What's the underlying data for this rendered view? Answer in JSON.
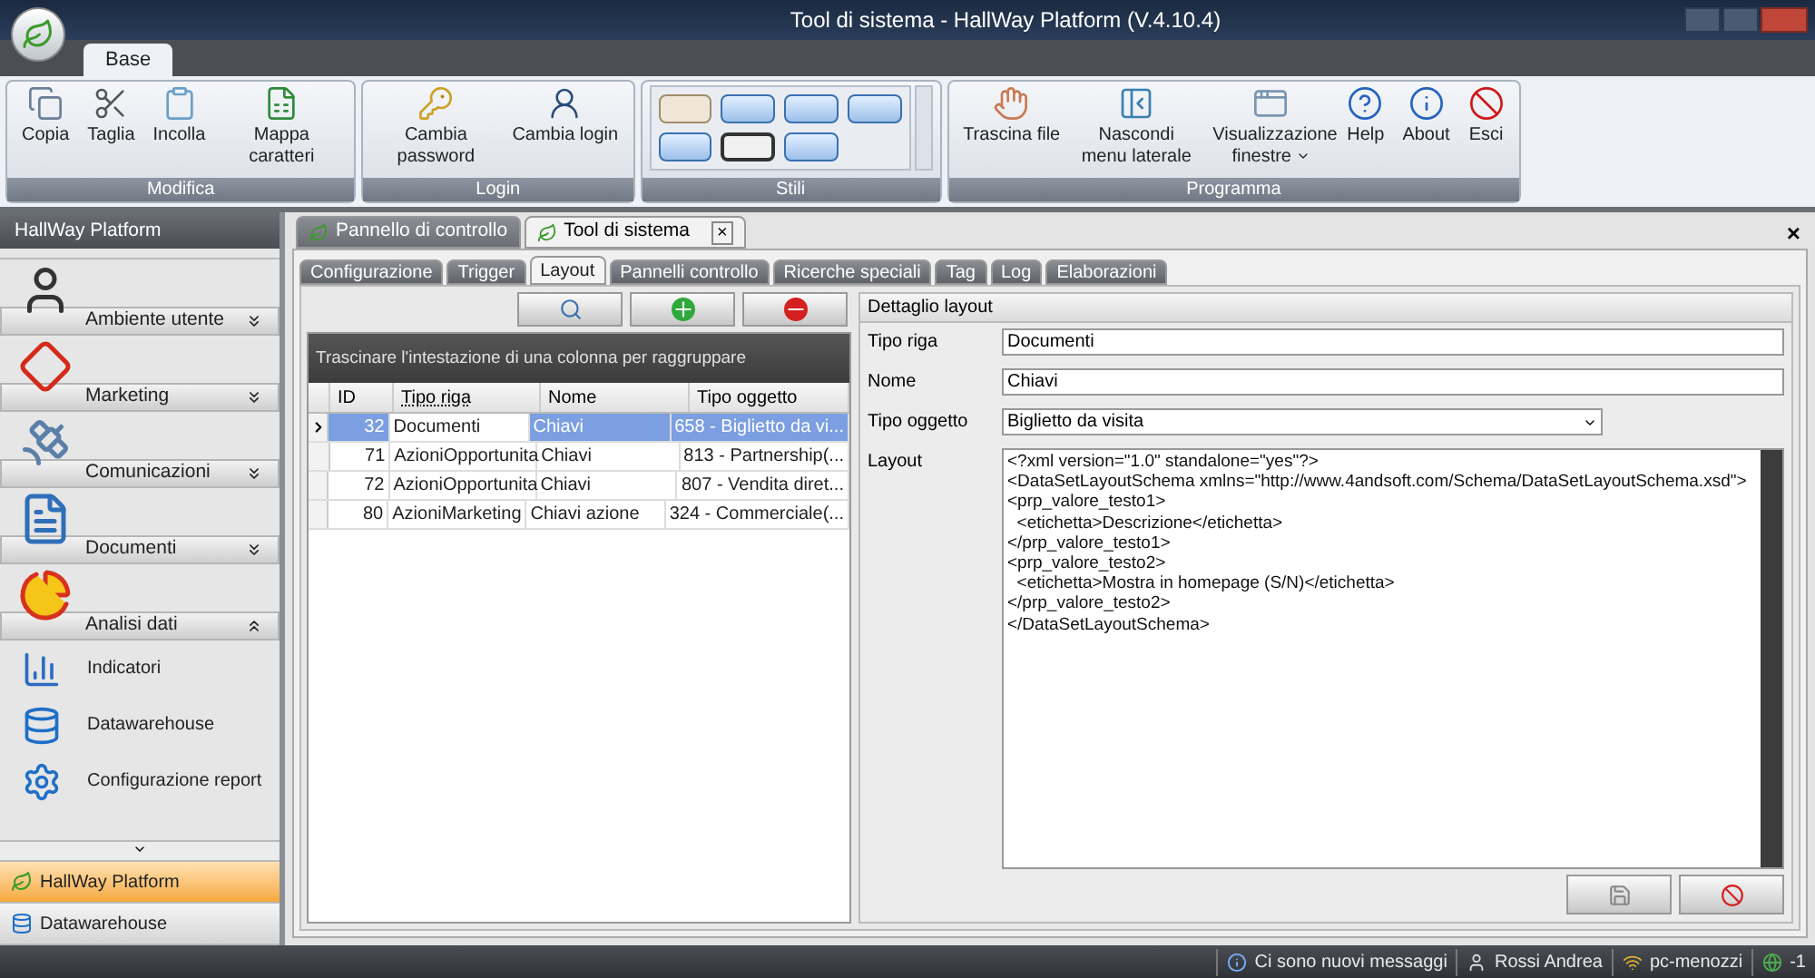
{
  "window": {
    "title": "Tool di sistema - HallWay Platform (V.4.10.4)"
  },
  "ribbon": {
    "tabs": [
      {
        "label": "Base",
        "selected": true
      }
    ],
    "groups": [
      {
        "title": "Modifica",
        "kind": "buttons",
        "items": [
          {
            "label": "Copia"
          },
          {
            "label": "Taglia"
          },
          {
            "label": "Incolla"
          },
          {
            "label": "Mappa caratteri"
          }
        ]
      },
      {
        "title": "Login",
        "kind": "buttons",
        "items": [
          {
            "label": "Cambia password"
          },
          {
            "label": "Cambia login"
          }
        ]
      },
      {
        "title": "Stili",
        "kind": "gallery"
      },
      {
        "title": "Programma",
        "kind": "buttons",
        "items": [
          {
            "label": "Trascina file"
          },
          {
            "label": "Nascondi menu laterale"
          },
          {
            "label": "Visualizzazione finestre",
            "dropdown": true
          },
          {
            "label": "Help"
          },
          {
            "label": "About"
          },
          {
            "label": "Esci"
          }
        ]
      }
    ]
  },
  "sidebar": {
    "title": "HallWay Platform",
    "groups": [
      {
        "label": "Ambiente utente",
        "expanded": false
      },
      {
        "label": "Marketing",
        "expanded": false
      },
      {
        "label": "Comunicazioni",
        "expanded": false
      },
      {
        "label": "Documenti",
        "expanded": false
      },
      {
        "label": "Analisi dati",
        "expanded": true,
        "items": [
          "Indicatori",
          "Datawarehouse",
          "Configurazione report"
        ]
      }
    ],
    "nav": [
      {
        "label": "HallWay Platform",
        "selected": true
      },
      {
        "label": "Datawarehouse",
        "selected": false
      }
    ]
  },
  "doc_tabs": [
    {
      "label": "Pannello di controllo",
      "selected": false,
      "closable": false
    },
    {
      "label": "Tool di sistema",
      "selected": true,
      "closable": true,
      "close_label": "×"
    }
  ],
  "close_all": "×",
  "tabs": [
    {
      "label": "Configurazione",
      "selected": false
    },
    {
      "label": "Trigger",
      "selected": false
    },
    {
      "label": "Layout",
      "selected": true
    },
    {
      "label": "Pannelli controllo",
      "selected": false
    },
    {
      "label": "Ricerche speciali",
      "selected": false
    },
    {
      "label": "Tag",
      "selected": false
    },
    {
      "label": "Log",
      "selected": false
    },
    {
      "label": "Elaborazioni",
      "selected": false
    }
  ],
  "grid": {
    "group_panel": "Trascinare l'intestazione di una colonna per raggruppare",
    "columns": [
      {
        "label": "ID",
        "focused": false
      },
      {
        "label": "Tipo riga",
        "focused": true
      },
      {
        "label": "Nome",
        "focused": false
      },
      {
        "label": "Tipo oggetto",
        "focused": false
      }
    ],
    "rows": [
      {
        "cells": [
          "32",
          "Documenti",
          "Chiavi",
          "658 - Biglietto da vi..."
        ],
        "selected": true
      },
      {
        "cells": [
          "71",
          "AzioniOpportunita",
          "Chiavi",
          "813 - Partnership(..."
        ],
        "selected": false
      },
      {
        "cells": [
          "72",
          "AzioniOpportunita",
          "Chiavi",
          "807 - Vendita diret..."
        ],
        "selected": false
      },
      {
        "cells": [
          "80",
          "AzioniMarketing",
          "Chiavi azione",
          "324 - Commerciale(..."
        ],
        "selected": false
      }
    ]
  },
  "detail": {
    "title": "Dettaglio layout",
    "fields": [
      {
        "label": "Tipo riga",
        "kind": "text",
        "value": "Documenti"
      },
      {
        "label": "Nome",
        "kind": "text",
        "value": "Chiavi"
      },
      {
        "label": "Tipo oggetto",
        "kind": "dropdown",
        "value": "Biglietto da visita"
      },
      {
        "label": "Layout",
        "kind": "textarea",
        "lines": [
          "<?xml version=\"1.0\" standalone=\"yes\"?>",
          "<DataSetLayoutSchema xmlns=\"http://www.4andsoft.com/Schema/DataSetLayoutSchema.xsd\">",
          "<prp_valore_testo1>",
          "  <etichetta>Descrizione</etichetta>",
          "</prp_valore_testo1>",
          "<prp_valore_testo2>",
          "  <etichetta>Mostra in homepage (S/N)</etichetta>",
          "</prp_valore_testo2>",
          "</DataSetLayoutSchema>"
        ]
      }
    ]
  },
  "status_bar": [
    {
      "text": "Ci sono nuovi messaggi"
    },
    {
      "text": "Rossi Andrea"
    },
    {
      "text": "pc-menozzi"
    },
    {
      "text": "-1"
    }
  ]
}
